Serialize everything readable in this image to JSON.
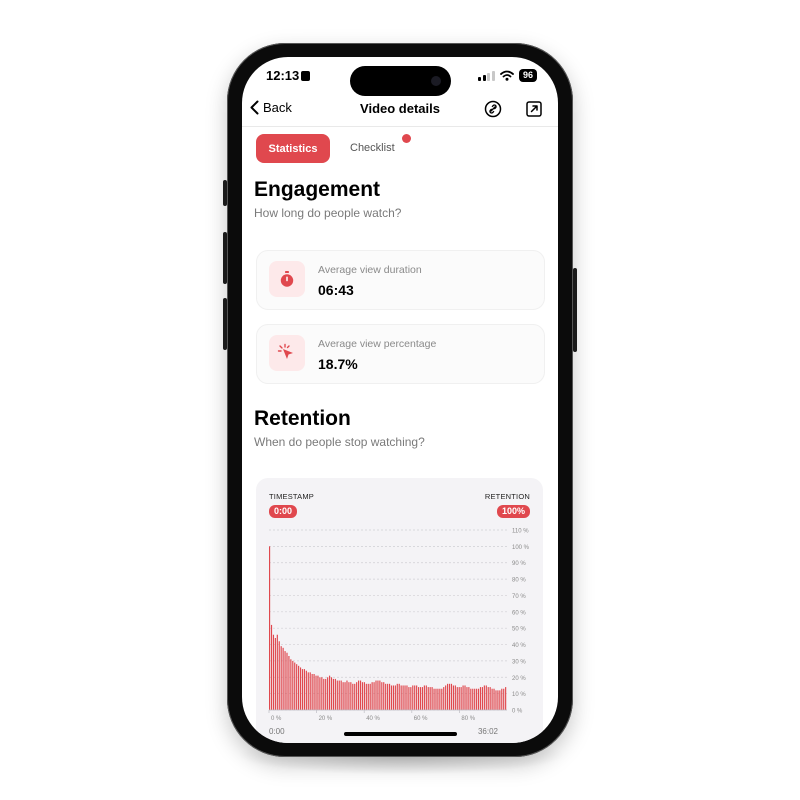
{
  "status": {
    "time": "12:13",
    "battery": "96"
  },
  "nav": {
    "back_label": "Back",
    "title": "Video details"
  },
  "tabs": [
    {
      "label": "Statistics",
      "active": true
    },
    {
      "label": "Checklist",
      "active": false,
      "has_notification": true
    }
  ],
  "engagement": {
    "title": "Engagement",
    "subtitle": "How long do people watch?",
    "cards": [
      {
        "label": "Average view duration",
        "value": "06:43",
        "icon": "stopwatch-icon"
      },
      {
        "label": "Average view percentage",
        "value": "18.7%",
        "icon": "cursor-click-icon"
      }
    ]
  },
  "retention": {
    "title": "Retention",
    "subtitle": "When do people stop watching?",
    "timestamp_label": "TIMESTAMP",
    "timestamp_value": "0:00",
    "retention_label": "RETENTION",
    "retention_value": "100%"
  },
  "colors": {
    "accent": "#e0484e",
    "accent_light": "#fde9ea"
  },
  "chart_data": {
    "type": "bar",
    "y_ticks": [
      "110 %",
      "100 %",
      "90 %",
      "80 %",
      "70 %",
      "60 %",
      "50 %",
      "40 %",
      "30 %",
      "20 %",
      "10 %",
      "0 %"
    ],
    "ylim": [
      0,
      110
    ],
    "x_ticks": [
      "0 %",
      "20 %",
      "40 %",
      "60 %",
      "80 %"
    ],
    "x_start": "0:00",
    "x_end": "36:02",
    "grid": true,
    "values": [
      100,
      52,
      46,
      44,
      46,
      42,
      39,
      38,
      36,
      35,
      33,
      31,
      30,
      29,
      28,
      27,
      26,
      25,
      25,
      24,
      23,
      23,
      22,
      22,
      21,
      21,
      20,
      20,
      19,
      19,
      20,
      21,
      20,
      19,
      19,
      18,
      18,
      18,
      17,
      17,
      18,
      17,
      17,
      16,
      16,
      17,
      18,
      18,
      17,
      17,
      16,
      16,
      16,
      17,
      17,
      18,
      18,
      18,
      17,
      17,
      16,
      16,
      16,
      15,
      15,
      15,
      16,
      16,
      15,
      15,
      15,
      15,
      14,
      14,
      15,
      15,
      15,
      14,
      14,
      14,
      15,
      15,
      14,
      14,
      14,
      13,
      13,
      13,
      13,
      13,
      14,
      15,
      16,
      16,
      16,
      15,
      15,
      14,
      14,
      14,
      15,
      15,
      14,
      14,
      13,
      13,
      13,
      13,
      13,
      14,
      14,
      15,
      15,
      14,
      14,
      13,
      13,
      12,
      12,
      12,
      13,
      13,
      14
    ]
  }
}
